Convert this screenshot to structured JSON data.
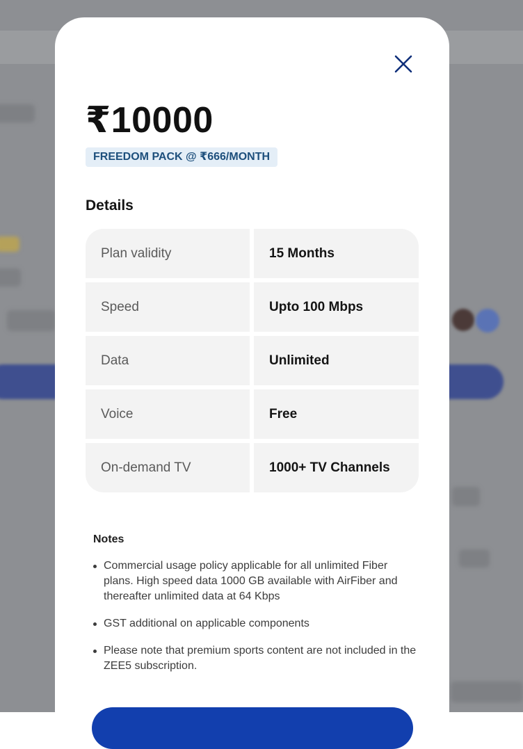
{
  "colors": {
    "accent": "#123fae",
    "close_icon": "#0f2f7a",
    "badge_bg": "#e4eef7",
    "badge_text": "#1d4f7c",
    "cell_bg": "#f3f3f3"
  },
  "modal": {
    "close_icon": "close-icon",
    "price": "₹10000",
    "pack_badge": "FREEDOM PACK @ ₹666/MONTH",
    "details_heading": "Details",
    "details": [
      {
        "label": "Plan validity",
        "value": "15 Months"
      },
      {
        "label": "Speed",
        "value": "Upto 100 Mbps"
      },
      {
        "label": "Data",
        "value": "Unlimited"
      },
      {
        "label": "Voice",
        "value": "Free"
      },
      {
        "label": "On-demand TV",
        "value": "1000+ TV Channels"
      }
    ],
    "notes_heading": "Notes",
    "notes": [
      "Commercial usage policy applicable for all unlimited Fiber plans. High speed data 1000 GB available with AirFiber and thereafter unlimited data at 64 Kbps",
      "GST additional on applicable components",
      "Please note that premium sports content are not included in the ZEE5 subscription."
    ]
  }
}
